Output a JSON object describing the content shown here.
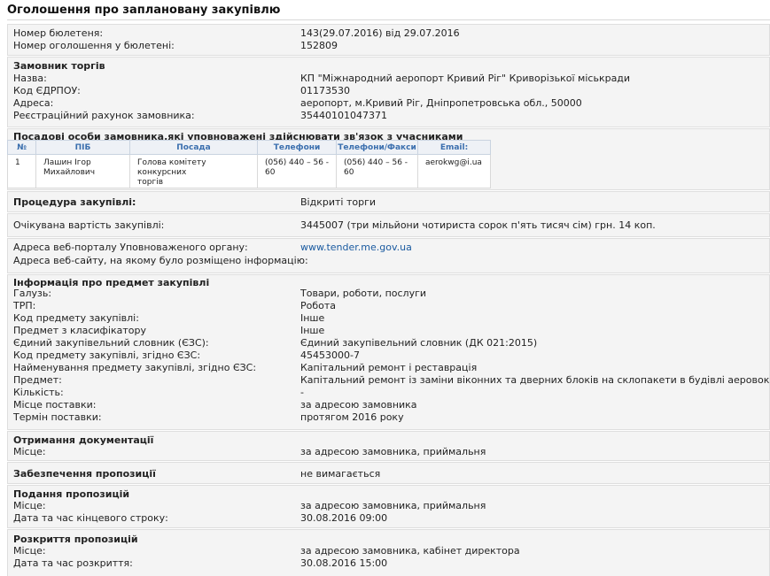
{
  "page": {
    "title": "Оголошення про заплановану закупівлю"
  },
  "bulletin": {
    "number_label": "Номер бюлетеня:",
    "number_value": "143(29.07.2016) від 29.07.2016",
    "ad_label": "Номер оголошення у бюлетені:",
    "ad_value": "152809"
  },
  "customer": {
    "heading": "Замовник торгів",
    "name_label": "Назва:",
    "name_value": "КП \"Міжнародний аеропорт Кривий Ріг\" Криворізької міськради",
    "edrpou_label": "Код ЄДРПОУ:",
    "edrpou_value": "01173530",
    "address_label": "Адреса:",
    "address_value": "аеропорт, м.Кривий Ріг, Дніпропетровська обл., 50000",
    "account_label": "Реєстраційний рахунок замовника:",
    "account_value": "35440101047371"
  },
  "contacts": {
    "heading": "Посадові особи замовника,які уповноважені здійснювати зв'язок з учасниками",
    "columns": [
      "№",
      "ПІБ",
      "Посада",
      "Телефони",
      "Телефони/Факси",
      "Email:"
    ],
    "row": {
      "num": "1",
      "name_1": "Лашин Ігор",
      "name_2": "Михайлович",
      "position_1": "Голова комітету конкурсних",
      "position_2": "торгів",
      "phone_1": "(056) 440 – 56 -",
      "phone_2": "60",
      "fax_1": "(056) 440 – 56 -",
      "fax_2": "60",
      "email": "aerokwg@i.ua"
    }
  },
  "procedure": {
    "label": "Процедура закупівлі:",
    "value": "Відкриті торги"
  },
  "cost": {
    "label": "Очікувана вартість закупівлі:",
    "value": "3445007 (три мільйони чотириста сорок п'ять тисяч сім) грн. 14 коп."
  },
  "portal": {
    "label1": "Адреса веб-порталу Уповноваженого органу:",
    "url": "www.tender.me.gov.ua",
    "label2": "Адреса веб-сайту, на якому було розміщено інформацію:"
  },
  "subject": {
    "heading": "Інформація про предмет закупівлі",
    "rows": [
      {
        "label": "Галузь:",
        "value": "Товари, роботи, послуги"
      },
      {
        "label": "ТРП:",
        "value": "Робота"
      },
      {
        "label": "Код предмету закупівлі:",
        "value": "Інше"
      },
      {
        "label": "Предмет з класифікатору",
        "value": "Інше"
      },
      {
        "label": "Єдиний закупівельний словник (ЄЗС):",
        "value": "Єдиний закупівельний словник (ДК 021:2015)"
      },
      {
        "label": "Код предмету закупівлі, згідно ЄЗС:",
        "value": "45453000-7"
      },
      {
        "label": "Найменування предмету закупівлі, згідно ЄЗС:",
        "value": "Капітальний ремонт і реставрація"
      },
      {
        "label": "Предмет:",
        "value": "Капітальний ремонт із заміни віконних та дверних блоків на склопакети в будівлі аеровокзалу"
      },
      {
        "label": "Кількість:",
        "value": "-"
      },
      {
        "label": "Місце поставки:",
        "value": "за адресою замовника"
      },
      {
        "label": "Термін поставки:",
        "value": "протягом 2016 року"
      }
    ]
  },
  "documentation": {
    "heading": "Отримання документації",
    "place_label": "Місце:",
    "place_value": "за адресою замовника, приймальня"
  },
  "security": {
    "label": "Забезпечення пропозиції",
    "value": "не вимагається"
  },
  "submission": {
    "heading": "Подання пропозицій",
    "place_label": "Місце:",
    "place_value": "за адресою замовника, приймальня",
    "deadline_label": "Дата та час кінцевого строку:",
    "deadline_value": "30.08.2016 09:00"
  },
  "opening": {
    "heading": "Розкриття пропозицій",
    "place_label": "Місце:",
    "place_value": "за адресою замовника, кабінет директора",
    "date_label": "Дата та час розкриття:",
    "date_value": "30.08.2016 15:00"
  }
}
